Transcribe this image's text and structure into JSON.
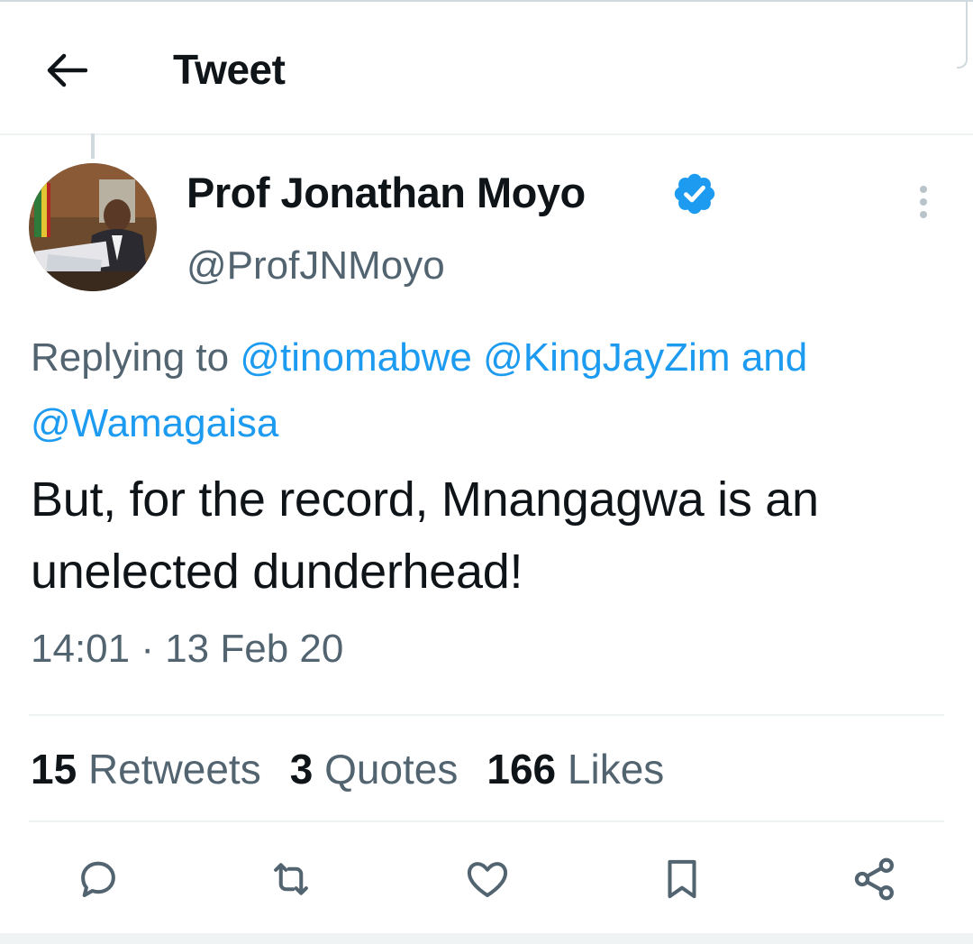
{
  "header": {
    "title": "Tweet",
    "back_icon": "arrow-left-icon"
  },
  "author": {
    "display_name": "Prof Jonathan Moyo",
    "handle": "@ProfJNMoyo",
    "verified": true,
    "verified_color": "#1d9bf0"
  },
  "reply_context": {
    "prefix": "Replying to",
    "mentions": [
      "@tinomabwe",
      "@KingJayZim"
    ],
    "joiner": "and",
    "last_mention": "@Wamagaisa"
  },
  "tweet": {
    "text": "But, for the record, Mnangagwa is an unelected dunderhead!",
    "timestamp": "14:01 · 13 Feb 20"
  },
  "stats": [
    {
      "count": "15",
      "label": "Retweets"
    },
    {
      "count": "3",
      "label": "Quotes"
    },
    {
      "count": "166",
      "label": "Likes"
    }
  ],
  "actions": [
    {
      "name": "reply",
      "icon": "reply-bubble-icon"
    },
    {
      "name": "retweet",
      "icon": "retweet-icon"
    },
    {
      "name": "like",
      "icon": "heart-icon"
    },
    {
      "name": "bookmark",
      "icon": "bookmark-icon"
    },
    {
      "name": "share",
      "icon": "share-icon"
    }
  ],
  "colors": {
    "text": "#0f1419",
    "secondary": "#536471",
    "link": "#1d9bf0",
    "divider": "#eff3f4"
  }
}
